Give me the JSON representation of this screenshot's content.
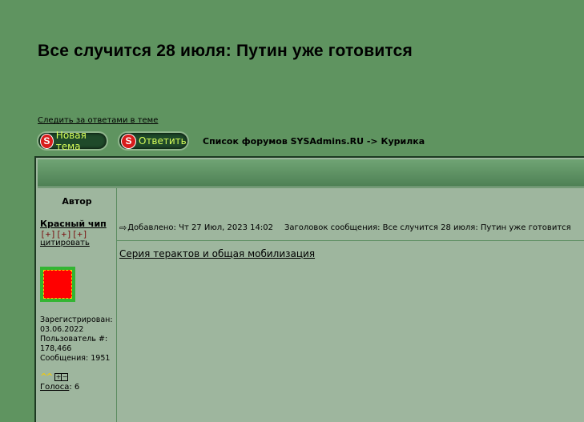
{
  "topic": {
    "title": "Все случится 28 июля: Путин уже готовится",
    "watch_link": "Следить за ответами в теме"
  },
  "buttons": {
    "new_topic": "Новая тема",
    "reply": "Ответить",
    "icon_letter": "S"
  },
  "breadcrumb": {
    "forum_index": "Список форумов SYSAdmins.RU",
    "separator": " -> ",
    "forum": "Курилка"
  },
  "table": {
    "author_header": "Автор"
  },
  "post": {
    "author": {
      "username": "Красный чип",
      "rank": "[+][+][+]",
      "quote_link": "цитировать",
      "meta": "Зарегистрирован:\n03.06.2022\nПользователь #:\n178,466\nСообщения: 1951",
      "votes_label": "Голоса",
      "votes_value": ": 6",
      "rank_chevrons": "^^"
    },
    "added_label": "Добавлено: Чт 27 Июл, 2023 14:02",
    "subject_label": "Заголовок сообщения: Все случится 28 июля: Путин уже готовится",
    "body_link": "Серия терактов и общая мобилизация"
  },
  "colors": {
    "background": "#5f9460",
    "panel": "#9eb69e",
    "button_text": "#d8ff5a",
    "icon_red": "#d81c1c",
    "rank_color": "#7a1212"
  }
}
